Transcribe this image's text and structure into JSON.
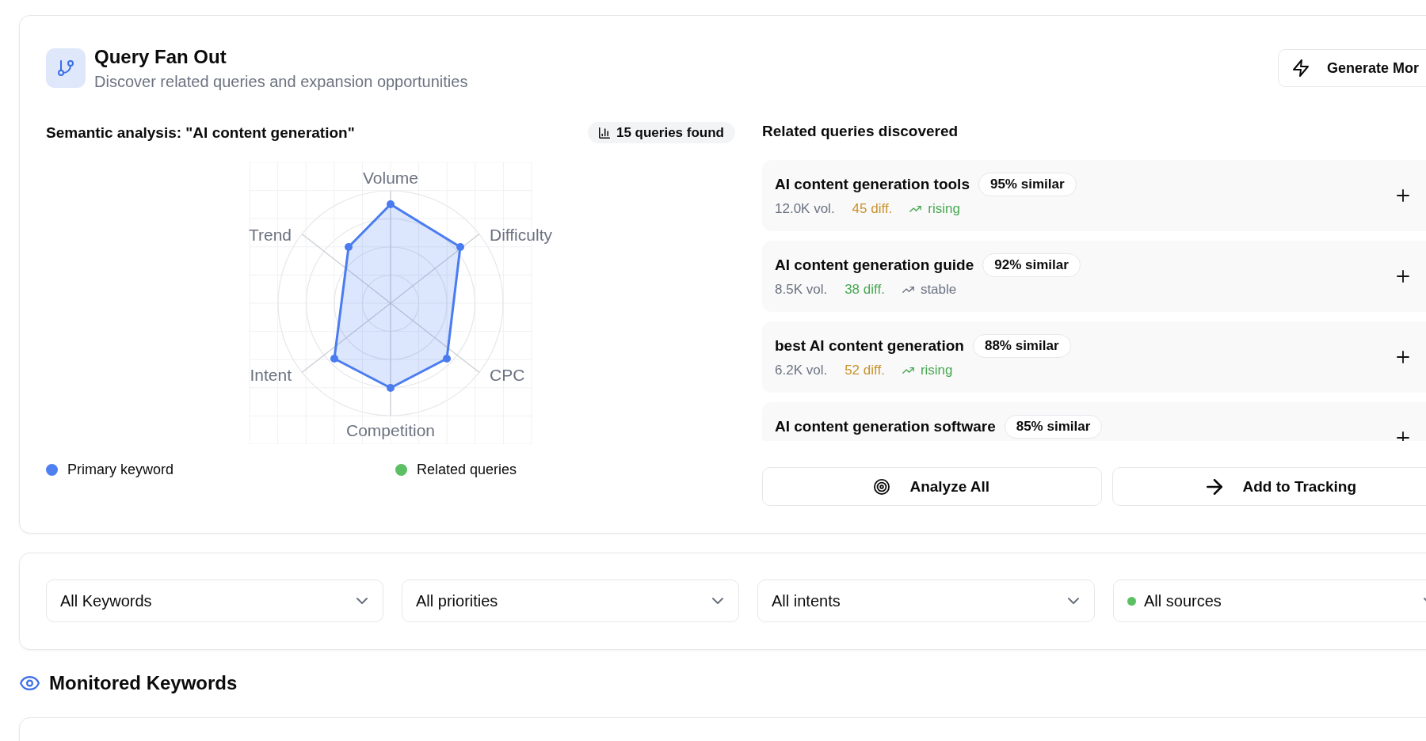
{
  "header": {
    "title": "Query Fan Out",
    "subtitle": "Discover related queries and expansion opportunities",
    "action_button": "Generate Mor"
  },
  "analysis": {
    "title": "Semantic analysis: \"AI content generation\"",
    "count_badge": "15 queries found",
    "radar_axes": [
      "Volume",
      "Difficulty",
      "CPC",
      "Competition",
      "Intent",
      "Trend"
    ],
    "legend": [
      {
        "label": "Primary keyword",
        "color": "#4f80ef"
      },
      {
        "label": "Related queries",
        "color": "#5cbf63"
      }
    ]
  },
  "related": {
    "heading": "Related queries discovered",
    "queries": [
      {
        "title": "AI content generation tools",
        "similarity": "95% similar",
        "volume": "12.0K vol.",
        "difficulty": {
          "text": "45 diff.",
          "color": "#c8922a"
        },
        "trend": {
          "text": "rising",
          "color": "#47a851"
        }
      },
      {
        "title": "AI content generation guide",
        "similarity": "92% similar",
        "volume": "8.5K vol.",
        "difficulty": {
          "text": "38 diff.",
          "color": "#47a851"
        },
        "trend": {
          "text": "stable",
          "color": "#6b7280"
        }
      },
      {
        "title": "best AI content generation",
        "similarity": "88% similar",
        "volume": "6.2K vol.",
        "difficulty": {
          "text": "52 diff.",
          "color": "#c8922a"
        },
        "trend": {
          "text": "rising",
          "color": "#47a851"
        }
      },
      {
        "title": "AI content generation software",
        "similarity": "85% similar"
      }
    ],
    "actions": [
      {
        "label": "Analyze All",
        "kind": "analyze"
      },
      {
        "label": "Add to Tracking",
        "kind": "track"
      }
    ]
  },
  "filters": [
    {
      "value": "All Keywords"
    },
    {
      "value": "All priorities"
    },
    {
      "value": "All intents"
    },
    {
      "value": "All sources",
      "color": "#5cbf63"
    }
  ],
  "monitored": {
    "title": "Monitored Keywords"
  }
}
